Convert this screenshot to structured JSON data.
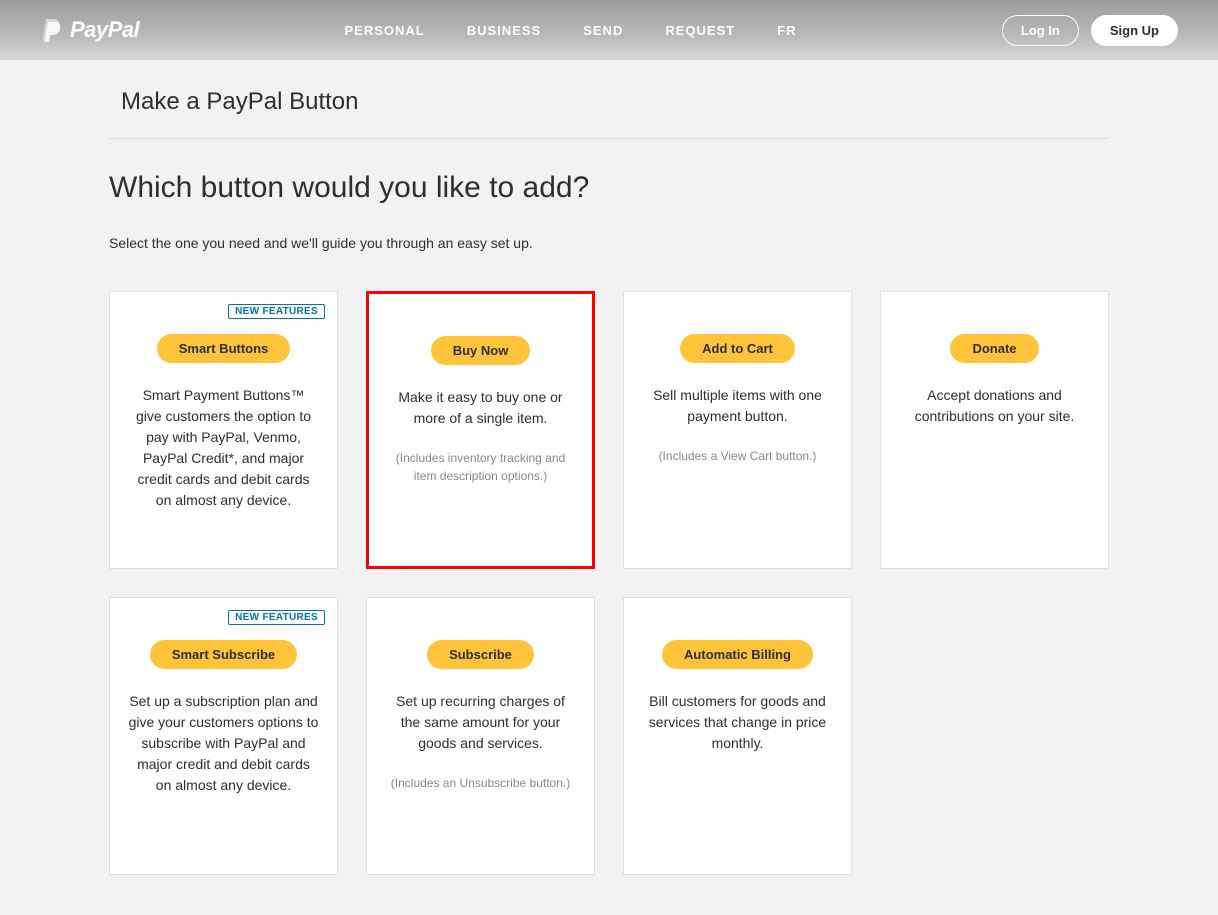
{
  "brand": "PayPal",
  "nav": {
    "items": [
      "PERSONAL",
      "BUSINESS",
      "SEND",
      "REQUEST",
      "FR"
    ]
  },
  "auth": {
    "login": "Log In",
    "signup": "Sign Up"
  },
  "page": {
    "title": "Make a PayPal Button",
    "question": "Which button would you like to add?",
    "subtext": "Select the one you need and we'll guide you through an easy set up."
  },
  "badge_text": "NEW FEATURES",
  "cards": [
    {
      "label": "Smart Buttons",
      "badge": true,
      "highlighted": false,
      "desc": "Smart Payment Buttons™ give customers the option to pay with PayPal, Venmo, PayPal Credit*, and major credit cards and debit cards on almost any device.",
      "note": ""
    },
    {
      "label": "Buy Now",
      "badge": false,
      "highlighted": true,
      "desc": "Make it easy to buy one or more of a single item.",
      "note": "(Includes inventory tracking and item description options.)"
    },
    {
      "label": "Add to Cart",
      "badge": false,
      "highlighted": false,
      "desc": "Sell multiple items with one payment button.",
      "note": "(Includes a View Cart button.)"
    },
    {
      "label": "Donate",
      "badge": false,
      "highlighted": false,
      "desc": "Accept donations and contributions on your site.",
      "note": ""
    },
    {
      "label": "Smart Subscribe",
      "badge": true,
      "highlighted": false,
      "desc": "Set up a subscription plan and give your customers options to subscribe with PayPal and major credit and debit cards on almost any device.",
      "note": ""
    },
    {
      "label": "Subscribe",
      "badge": false,
      "highlighted": false,
      "desc": "Set up recurring charges of the same amount for your goods and services.",
      "note": "(Includes an Unsubscribe button.)"
    },
    {
      "label": "Automatic Billing",
      "badge": false,
      "highlighted": false,
      "desc": "Bill customers for goods and services that change in price monthly.",
      "note": ""
    }
  ]
}
